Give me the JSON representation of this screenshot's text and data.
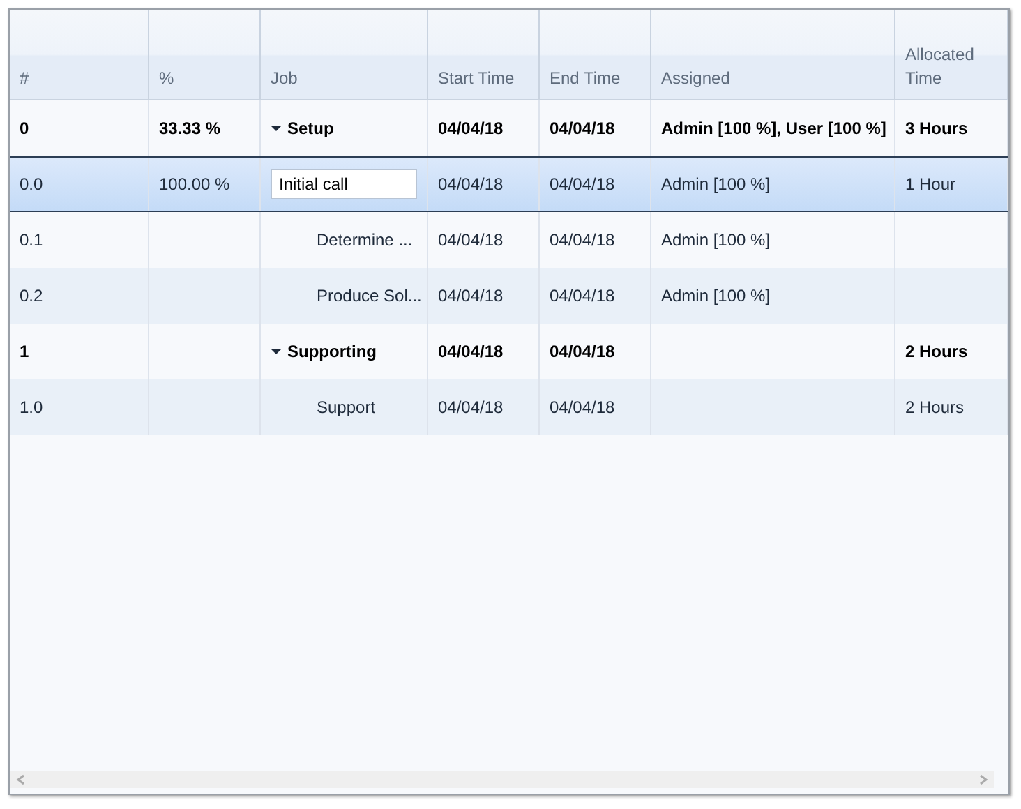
{
  "table": {
    "columns": [
      "#",
      "%",
      "Job",
      "Start Time",
      "End Time",
      "Assigned",
      "Allocated Time"
    ],
    "rows": [
      {
        "kind": "group",
        "selected": false,
        "expanded": true,
        "id": "0",
        "percent": "33.33 %",
        "job": "Setup",
        "start": "04/04/18",
        "end": "04/04/18",
        "assigned": "Admin [100 %], User [100 %]",
        "allocated": "3 Hours",
        "children": [
          {
            "kind": "editing",
            "selected": true,
            "id": "0.0",
            "percent": "100.00 %",
            "job": "Initial call",
            "start": "04/04/18",
            "end": "04/04/18",
            "assigned": "Admin [100 %]",
            "allocated": "1 Hour"
          },
          {
            "kind": "task",
            "selected": false,
            "id": "0.1",
            "job": "Determine ...",
            "start": "04/04/18",
            "end": "04/04/18",
            "assigned": "Admin [100 %]"
          },
          {
            "kind": "task",
            "selected": false,
            "id": "0.2",
            "job": "Produce Sol...",
            "start": "04/04/18",
            "end": "04/04/18",
            "assigned": "Admin [100 %]"
          }
        ]
      },
      {
        "kind": "group",
        "selected": false,
        "expanded": true,
        "id": "1",
        "job": "Supporting",
        "start": "04/04/18",
        "end": "04/04/18",
        "allocated": "2 Hours",
        "children": [
          {
            "kind": "task",
            "selected": false,
            "id": "1.0",
            "job": "Support",
            "start": "04/04/18",
            "end": "04/04/18",
            "allocated": "2 Hours"
          }
        ]
      }
    ]
  }
}
